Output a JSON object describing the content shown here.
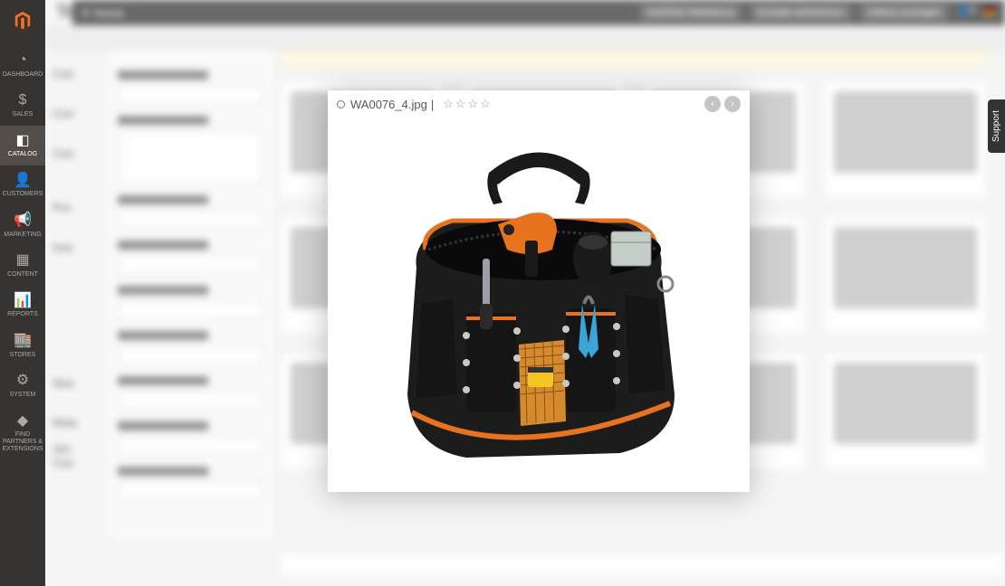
{
  "admin": {
    "page_title": "Tes",
    "nav": [
      {
        "icon": "◔",
        "label": "DASHBOARD"
      },
      {
        "icon": "$",
        "label": "SALES"
      },
      {
        "icon": "◧",
        "label": "CATALOG",
        "active": true
      },
      {
        "icon": "👤",
        "label": "CUSTOMERS"
      },
      {
        "icon": "📢",
        "label": "MARKETING"
      },
      {
        "icon": "▦",
        "label": "CONTENT"
      },
      {
        "icon": "📊",
        "label": "REPORTS"
      },
      {
        "icon": "🏬",
        "label": "STORES"
      },
      {
        "icon": "⚙",
        "label": "SYSTEM"
      },
      {
        "icon": "◆",
        "label": "FIND PARTNERS & EXTENSIONS"
      }
    ]
  },
  "topbar": {
    "brand": "✕ tessa",
    "buttons": [
      "Geführte Webdemo",
      "Kontakt aufnehmen",
      "Videos anzeigen"
    ]
  },
  "support_tab": "Support",
  "left_sections": [
    "Con",
    "Con",
    "Con",
    "Pro",
    "Ima",
    "Sea",
    "Rela",
    "Cus"
  ],
  "left_count": "384",
  "lightbox": {
    "filename": "WA0076_4.jpg",
    "separator": "|",
    "stars": "☆☆☆☆",
    "prev_icon": "‹",
    "next_icon": "›",
    "image_alt": "Black and orange tool bag filled with power drill, pliers, screwdrivers and accessories"
  }
}
